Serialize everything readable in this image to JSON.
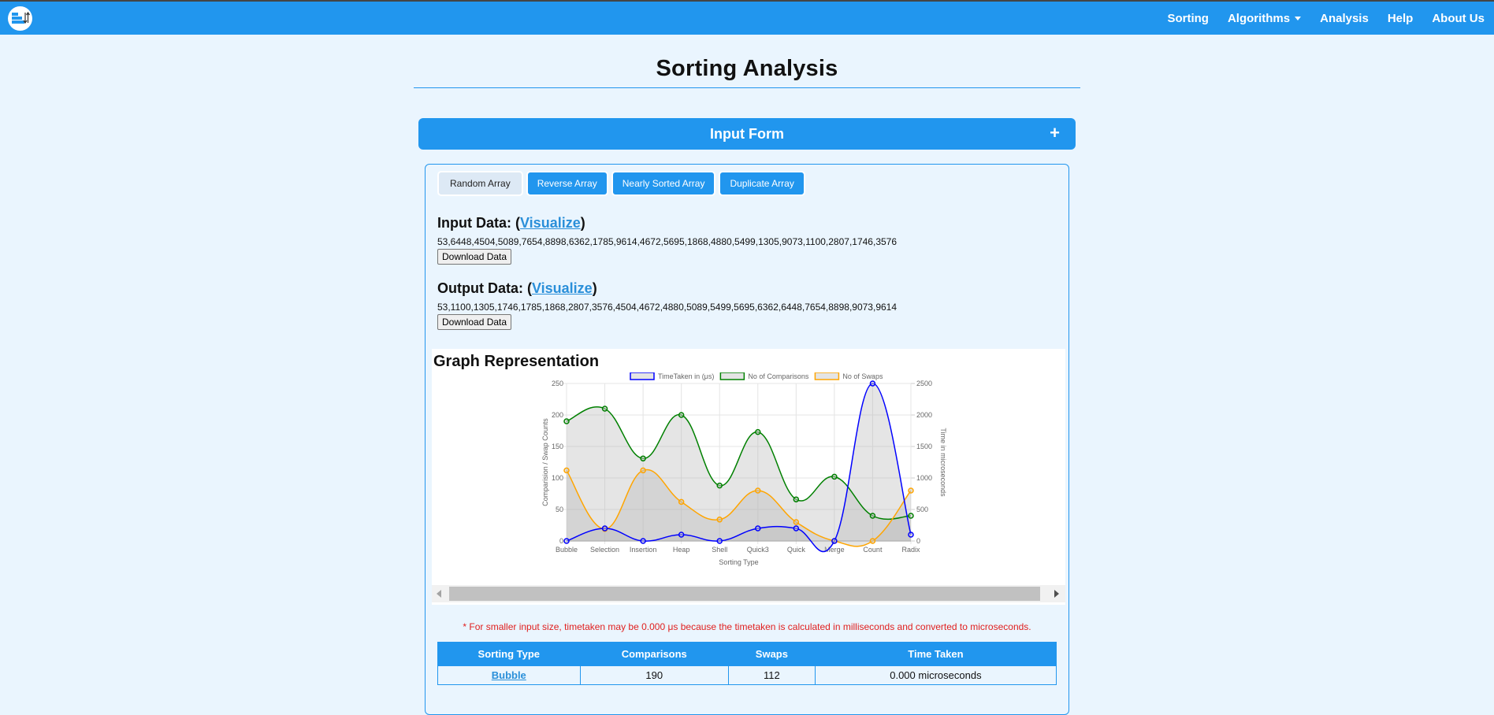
{
  "navbar": {
    "logo_icon": "sort-bars-icon",
    "links": [
      {
        "label": "Sorting"
      },
      {
        "label": "Algorithms",
        "dropdown": true
      },
      {
        "label": "Analysis"
      },
      {
        "label": "Help"
      },
      {
        "label": "About Us"
      }
    ]
  },
  "page": {
    "title": "Sorting Analysis"
  },
  "input_form": {
    "header": "Input Form",
    "toggle_icon": "+"
  },
  "array_buttons": [
    {
      "label": "Random Array",
      "active": true
    },
    {
      "label": "Reverse Array",
      "active": false
    },
    {
      "label": "Nearly Sorted Array",
      "active": false
    },
    {
      "label": "Duplicate Array",
      "active": false
    }
  ],
  "input_data": {
    "title": "Input Data:",
    "link": "Visualize",
    "values": "53,6448,4504,5089,7654,8898,6362,1785,9614,4672,5695,1868,4880,5499,1305,9073,1100,2807,1746,3576",
    "download_label": "Download Data"
  },
  "output_data": {
    "title": "Output Data:",
    "link": "Visualize",
    "values": "53,1100,1305,1746,1785,1868,2807,3576,4504,4672,4880,5089,5499,5695,6362,6448,7654,8898,9073,9614",
    "download_label": "Download Data"
  },
  "graph": {
    "title": "Graph Representation"
  },
  "chart_data": {
    "type": "line",
    "categories": [
      "Bubble",
      "Selection",
      "Insertion",
      "Heap",
      "Shell",
      "Quick3",
      "Quick",
      "Merge",
      "Count",
      "Radix"
    ],
    "series": [
      {
        "name": "TimeTaken in (μs)",
        "axis": "right",
        "color": "#0000ff",
        "values": [
          0,
          200,
          0,
          100,
          0,
          200,
          200,
          0,
          2500,
          100
        ]
      },
      {
        "name": "No of Comparisons",
        "axis": "left",
        "color": "#008000",
        "values": [
          190,
          210,
          131,
          200,
          88,
          173,
          66,
          102,
          40,
          40
        ]
      },
      {
        "name": "No of Swaps",
        "axis": "left",
        "color": "#ffa500",
        "values": [
          112,
          19,
          112,
          62,
          34,
          80,
          30,
          0,
          0,
          80
        ]
      }
    ],
    "xlabel": "Sorting Type",
    "ylabel_left": "Comparision / Swap Counts",
    "ylabel_right": "Time in microseconds",
    "ylim_left": [
      0,
      250
    ],
    "yticks_left": [
      0,
      50,
      100,
      150,
      200,
      250
    ],
    "ylim_right": [
      0,
      2500
    ],
    "yticks_right": [
      0,
      500,
      1000,
      1500,
      2000,
      2500
    ],
    "legend": "top",
    "grid": true,
    "fill": "#bbbbbb"
  },
  "note": "* For smaller input size, timetaken may be 0.000 μs because the timetaken is calculated in milliseconds and converted to microseconds.",
  "table": {
    "headers": [
      "Sorting Type",
      "Comparisons",
      "Swaps",
      "Time Taken"
    ],
    "rows": [
      [
        "Bubble",
        "190",
        "112",
        "0.000 microseconds"
      ]
    ]
  }
}
